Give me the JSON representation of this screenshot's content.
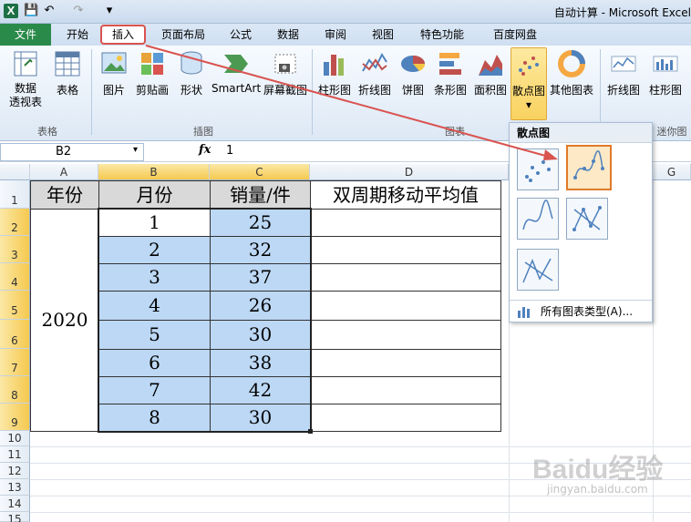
{
  "app": {
    "title": "自动计算 - Microsoft Excel",
    "logo_letter": "X"
  },
  "tabs": [
    {
      "label": "文件"
    },
    {
      "label": "开始"
    },
    {
      "label": "插入"
    },
    {
      "label": "页面布局"
    },
    {
      "label": "公式"
    },
    {
      "label": "数据"
    },
    {
      "label": "审阅"
    },
    {
      "label": "视图"
    },
    {
      "label": "特色功能"
    },
    {
      "label": "百度网盘"
    }
  ],
  "ribbon": {
    "pivot_table": "数据\n透视表",
    "table": "表格",
    "picture": "图片",
    "clipart": "剪贴画",
    "shapes": "形状",
    "smartart": "SmartArt",
    "screenshot": "屏幕截图",
    "column_chart": "柱形图",
    "line_chart": "折线图",
    "pie_chart": "饼图",
    "bar_chart": "条形图",
    "area_chart": "面积图",
    "scatter_chart": "散点图",
    "other_charts": "其他图表",
    "sparkline_line": "折线图",
    "sparkline_column": "柱形图",
    "group_tables": "表格",
    "group_illustrations": "插图",
    "group_charts": "图表",
    "group_sparklines": "迷你图"
  },
  "formula_bar": {
    "name_box": "B2",
    "fx": "fx",
    "value": "1"
  },
  "columns": [
    "A",
    "B",
    "C",
    "D",
    "G"
  ],
  "rows": [
    "1",
    "2",
    "3",
    "4",
    "5",
    "6",
    "7",
    "8",
    "9",
    "10",
    "11",
    "12",
    "13",
    "14",
    "15"
  ],
  "sheet": {
    "headers": {
      "year": "年份",
      "month": "月份",
      "sales": "销量/件",
      "avg": "双周期移动平均值"
    },
    "year_value": "2020",
    "months": [
      "1",
      "2",
      "3",
      "4",
      "5",
      "6",
      "7",
      "8"
    ],
    "sales": [
      "25",
      "32",
      "37",
      "26",
      "30",
      "38",
      "42",
      "30"
    ]
  },
  "dropdown": {
    "title": "散点图",
    "all_types": "所有图表类型(A)..."
  },
  "watermark": {
    "brand": "Baidu经验",
    "url": "jingyan.baidu.com"
  }
}
